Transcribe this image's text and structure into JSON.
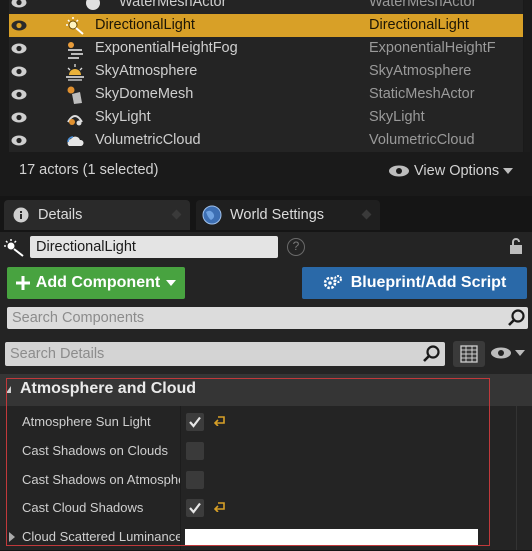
{
  "outliner": {
    "rows": [
      {
        "name": "WaterMeshActor",
        "type": "WaterMeshActor",
        "icon": "water-mesh-icon",
        "selected": false
      },
      {
        "name": "DirectionalLight",
        "type": "DirectionalLight",
        "icon": "directional-light-icon",
        "selected": true
      },
      {
        "name": "ExponentialHeightFog",
        "type": "ExponentialHeightF",
        "icon": "fog-icon",
        "selected": false
      },
      {
        "name": "SkyAtmosphere",
        "type": "SkyAtmosphere",
        "icon": "sky-atmosphere-icon",
        "selected": false
      },
      {
        "name": "SkyDomeMesh",
        "type": "StaticMeshActor",
        "icon": "static-mesh-icon",
        "selected": false
      },
      {
        "name": "SkyLight",
        "type": "SkyLight",
        "icon": "sky-light-icon",
        "selected": false
      },
      {
        "name": "VolumetricCloud",
        "type": "VolumetricCloud",
        "icon": "cloud-icon",
        "selected": false
      }
    ],
    "status": "17 actors (1 selected)",
    "view_options": "View Options"
  },
  "tabs": {
    "details": "Details",
    "world_settings": "World Settings"
  },
  "details": {
    "actor_name": "DirectionalLight",
    "help": "?",
    "add_component": "Add Component",
    "blueprint": "Blueprint/Add Script",
    "search_components_placeholder": "Search Components",
    "search_details_placeholder": "Search Details",
    "category": "Atmosphere and Cloud",
    "properties": [
      {
        "label": "Atmosphere Sun Light",
        "checked": true,
        "reset": true
      },
      {
        "label": "Cast Shadows on Clouds",
        "checked": false,
        "reset": false
      },
      {
        "label": "Cast Shadows on Atmosphere",
        "checked": false,
        "reset": false
      },
      {
        "label": "Cast Cloud Shadows",
        "checked": true,
        "reset": true
      },
      {
        "label": "Cloud Scattered Luminance",
        "color": "#ffffff"
      }
    ]
  },
  "colors": {
    "selection": "#d8a027",
    "add_button": "#48a340",
    "blueprint_button": "#2a69a8",
    "highlight_box": "#c0393b"
  }
}
